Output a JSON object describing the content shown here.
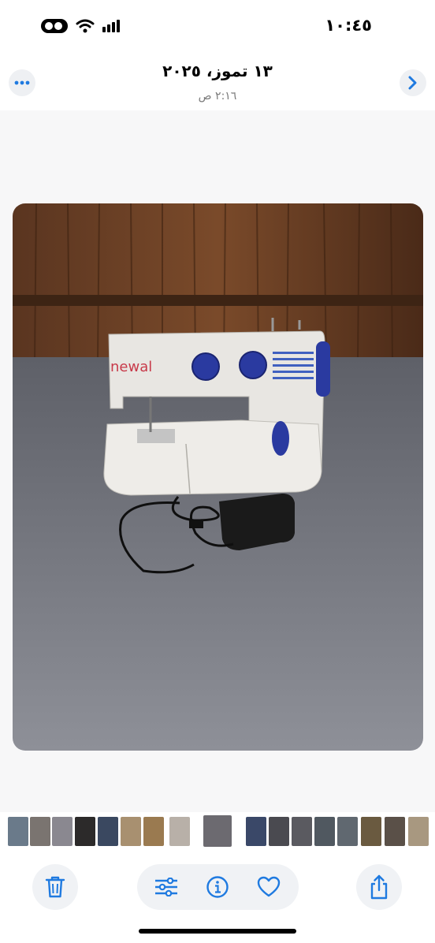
{
  "status_bar": {
    "time": "١٠:٤٥"
  },
  "header": {
    "title": "١٣ تموز، ٢٠٢٥",
    "subtitle": "٢:١٦ ص"
  },
  "photo": {
    "brand_text": "newal"
  },
  "colors": {
    "accent": "#1f7ae0",
    "button_bg": "#f0f2f5",
    "viewer_bg": "#f7f7f8"
  },
  "toolbar": {
    "icons": [
      "trash-icon",
      "adjust-icon",
      "info-icon",
      "heart-icon",
      "share-icon"
    ]
  }
}
